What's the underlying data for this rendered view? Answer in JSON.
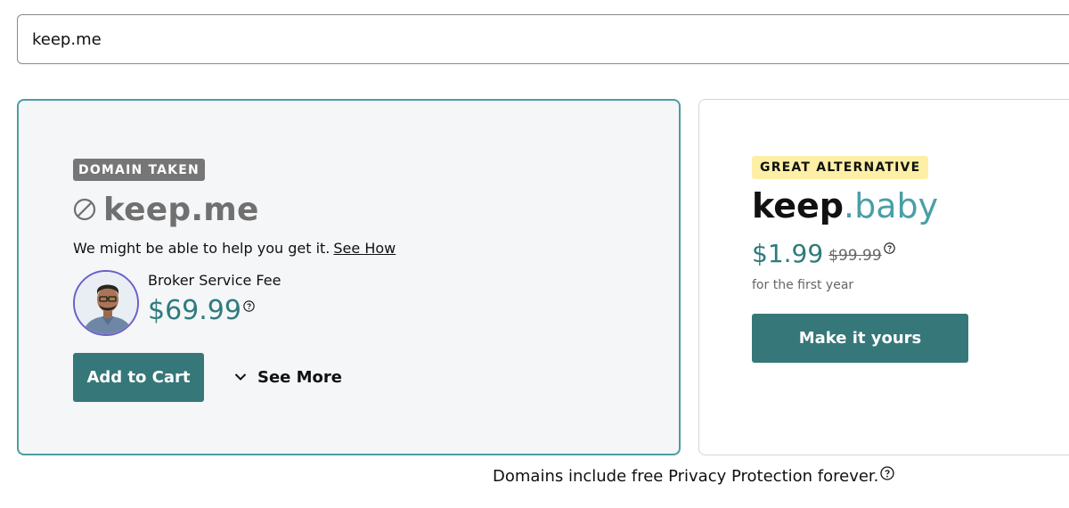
{
  "search": {
    "value": "keep.me"
  },
  "taken_card": {
    "badge": "DOMAIN TAKEN",
    "domain": "keep.me",
    "help_text": "We might be able to help you get it.",
    "help_link": "See How",
    "broker_label": "Broker Service Fee",
    "broker_price": "$69.99",
    "add_to_cart": "Add to Cart",
    "see_more": "See More",
    "status_icon": "ban-icon"
  },
  "alt_card": {
    "badge": "GREAT ALTERNATIVE",
    "sld": "keep",
    "tld": ".baby",
    "price": "$1.99",
    "old_price": "$99.99",
    "term_text": "for the first year",
    "cta": "Make it yours"
  },
  "footer": {
    "privacy_note": "Domains include free Privacy Protection forever."
  },
  "colors": {
    "accent_teal": "#367779",
    "price_teal": "#2f7b7e",
    "tld_teal": "#4a9fa6",
    "taken_border": "#4b9ea0",
    "taken_badge_bg": "#767676",
    "alt_badge_bg": "#fdf0a6",
    "avatar_ring": "#6c5fc7"
  }
}
